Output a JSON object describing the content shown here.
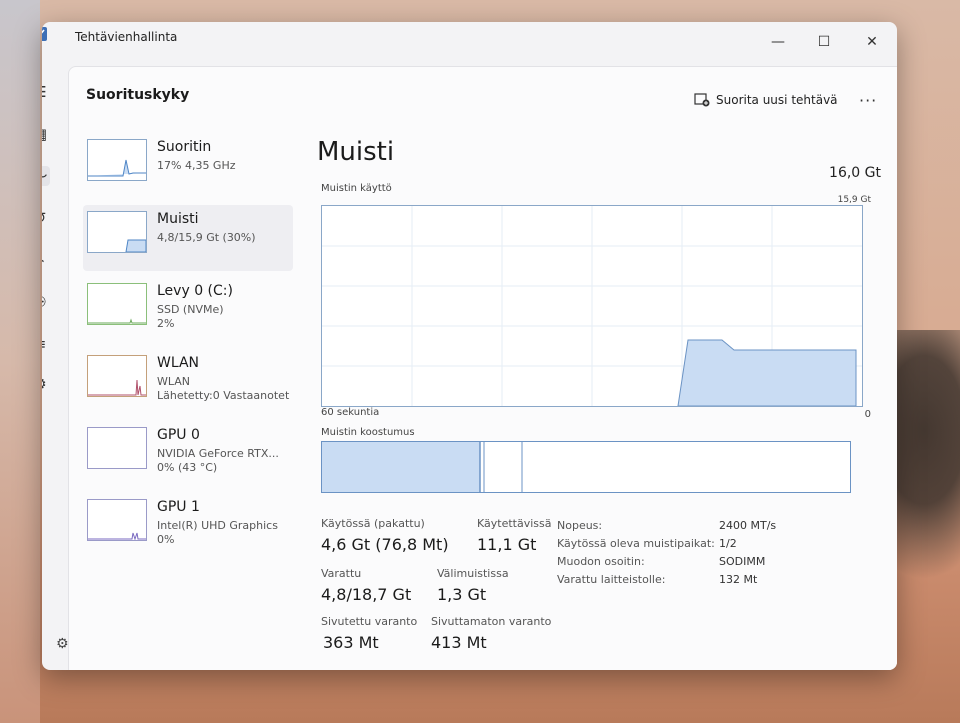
{
  "window": {
    "title": "Tehtävienhallinta",
    "minimize": "—",
    "maximize": "☐",
    "close": "✕"
  },
  "page": {
    "title": "Suorituskyky",
    "run_task": "Suorita uusi tehtävä",
    "more": "···"
  },
  "devices": [
    {
      "name": "Suoritin",
      "line1": "17% 4,35 GHz",
      "line2": ""
    },
    {
      "name": "Muisti",
      "line1": "4,8/15,9 Gt (30%)",
      "line2": ""
    },
    {
      "name": "Levy 0 (C:)",
      "line1": "SSD (NVMe)",
      "line2": "2%"
    },
    {
      "name": "WLAN",
      "line1": "WLAN",
      "line2": "Lähetetty:0 Vastaanotet"
    },
    {
      "name": "GPU 0",
      "line1": "NVIDIA GeForce RTX...",
      "line2": "0% (43 °C)"
    },
    {
      "name": "GPU 1",
      "line1": "Intel(R) UHD Graphics",
      "line2": "0%"
    }
  ],
  "memory": {
    "title": "Muisti",
    "total": "16,0 Gt",
    "usage_label": "Muistin käyttö",
    "usage_max": "15,9 Gt",
    "time_label": "60 sekuntia",
    "zero_label": "0",
    "composition_label": "Muistin koostumus"
  },
  "stats": {
    "in_use_label": "Käytössä (pakattu)",
    "in_use_value": "4,6 Gt (76,8 Mt)",
    "available_label": "Käytettävissä",
    "available_value": "11,1 Gt",
    "committed_label": "Varattu",
    "committed_value": "4,8/18,7 Gt",
    "cached_label": "Välimuistissa",
    "cached_value": "1,3 Gt",
    "paged_label": "Sivutettu varanto",
    "paged_value": "363 Mt",
    "nonpaged_label": "Sivuttamaton varanto",
    "nonpaged_value": "413 Mt"
  },
  "details": [
    {
      "key": "Nopeus:",
      "value": "2400 MT/s"
    },
    {
      "key": "Käytössä oleva muistipaikat:",
      "value": "1/2"
    },
    {
      "key": "Muodon osoitin:",
      "value": "SODIMM"
    },
    {
      "key": "Varattu laitteistolle:",
      "value": "132 Mt"
    }
  ],
  "colors": {
    "accent": "#6b93c4",
    "fill": "#c9dcf3",
    "selected": "#eeeef2"
  }
}
